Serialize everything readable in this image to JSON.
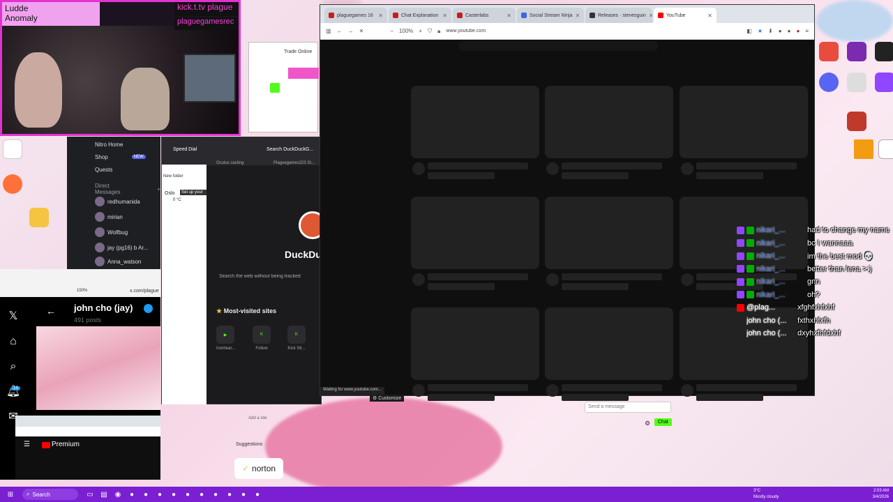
{
  "webcam": {
    "streamer_name": "Ludde",
    "streamer_sub": "Anomaly",
    "kick_tag": "kick.t.tv plague",
    "kick_tag2": "plaguegamesrec"
  },
  "discord": {
    "items": [
      {
        "label": "Nitro Home"
      },
      {
        "label": "Shop",
        "badge": "NEW"
      },
      {
        "label": "Quests"
      }
    ],
    "dm_header": "Direct Messages",
    "dms": [
      "redhumanida",
      "mirian",
      "Wolfbug",
      "jay (pg16) b Ar...",
      "Anna_watson"
    ],
    "status": "Trade Online"
  },
  "twitter": {
    "url": "x.com/plague",
    "zoom": "150%",
    "profile_name": "john cho (jay)",
    "posts": "491 posts",
    "notif_count": "19",
    "yt_label": "Premium"
  },
  "opera": {
    "tab1": "Speed Dial",
    "tab2": "Search DuckDuckG...",
    "bookmark1": "Oculus casting",
    "bookmark2": "Plaguegames223 St...",
    "new_folder": "New folder",
    "weather_city": "Oslo",
    "weather_temp": "0 °C",
    "setup_label": "Set up your",
    "brand": "DuckDu",
    "search_placeholder": "Search the web without being tracked",
    "most_visited": "Most-visited sites",
    "sites": [
      {
        "label": "Ironhear...",
        "color": "#53fc18"
      },
      {
        "label": "Follow",
        "color": "#53fc18"
      },
      {
        "label": "Kick Str...",
        "color": "#53fc18"
      }
    ],
    "customize": "Customize",
    "suggestions": "Suggestions",
    "add_site": "Add a site"
  },
  "youtube_window": {
    "tabs": [
      {
        "label": "plaguegames 16",
        "color": "#c41f1f"
      },
      {
        "label": "Chat Explanation",
        "color": "#c41f1f"
      },
      {
        "label": "Casterlabs",
        "color": "#c41f1f"
      },
      {
        "label": "Social Stream Ninja",
        "color": "#3a6ae0"
      },
      {
        "label": "Releases · stevesguin",
        "color": "#333333"
      },
      {
        "label": "YouTube",
        "color": "#ff0000",
        "active": true
      }
    ],
    "zoom": "100%",
    "url": "www.youtube.com",
    "status_text": "Waiting for www.youtube.com..."
  },
  "chat": {
    "lines": [
      {
        "user": "nikari_...",
        "msg": "had to change my name",
        "platform": "twitch"
      },
      {
        "user": "nikari_...",
        "msg": "bc I wannaaa",
        "platform": "twitch"
      },
      {
        "user": "nikari_...",
        "msg": "im the best mod 💀",
        "platform": "twitch"
      },
      {
        "user": "nikari_...",
        "msg": "better than lena >:)",
        "platform": "twitch"
      },
      {
        "user": "nikari_...",
        "msg": "gnn",
        "platform": "twitch"
      },
      {
        "user": "nikari_...",
        "msg": "oh?",
        "platform": "twitch"
      },
      {
        "user": "@plag...",
        "msg": "xfghfxhfxhf",
        "platform": "youtube"
      },
      {
        "user": "john cho (...",
        "msg": "fxthxhfxfh",
        "platform": "x"
      },
      {
        "user": "john cho (...",
        "msg": "dxyhxfhfdxhf",
        "platform": "x"
      }
    ]
  },
  "chat_input": {
    "placeholder": "Send a message",
    "button": "Chat"
  },
  "norton": "norton",
  "taskbar": {
    "search": "Search",
    "time": "2:03 AM",
    "date": "3/4/2026",
    "weather": "Mostly cloudy",
    "temp": "3°C"
  },
  "colors": {
    "taskbar": "#7a1fd2",
    "kick_green": "#53fc18",
    "twitch_purple": "#9146ff",
    "chat_user_blue": "#2c63d7"
  }
}
